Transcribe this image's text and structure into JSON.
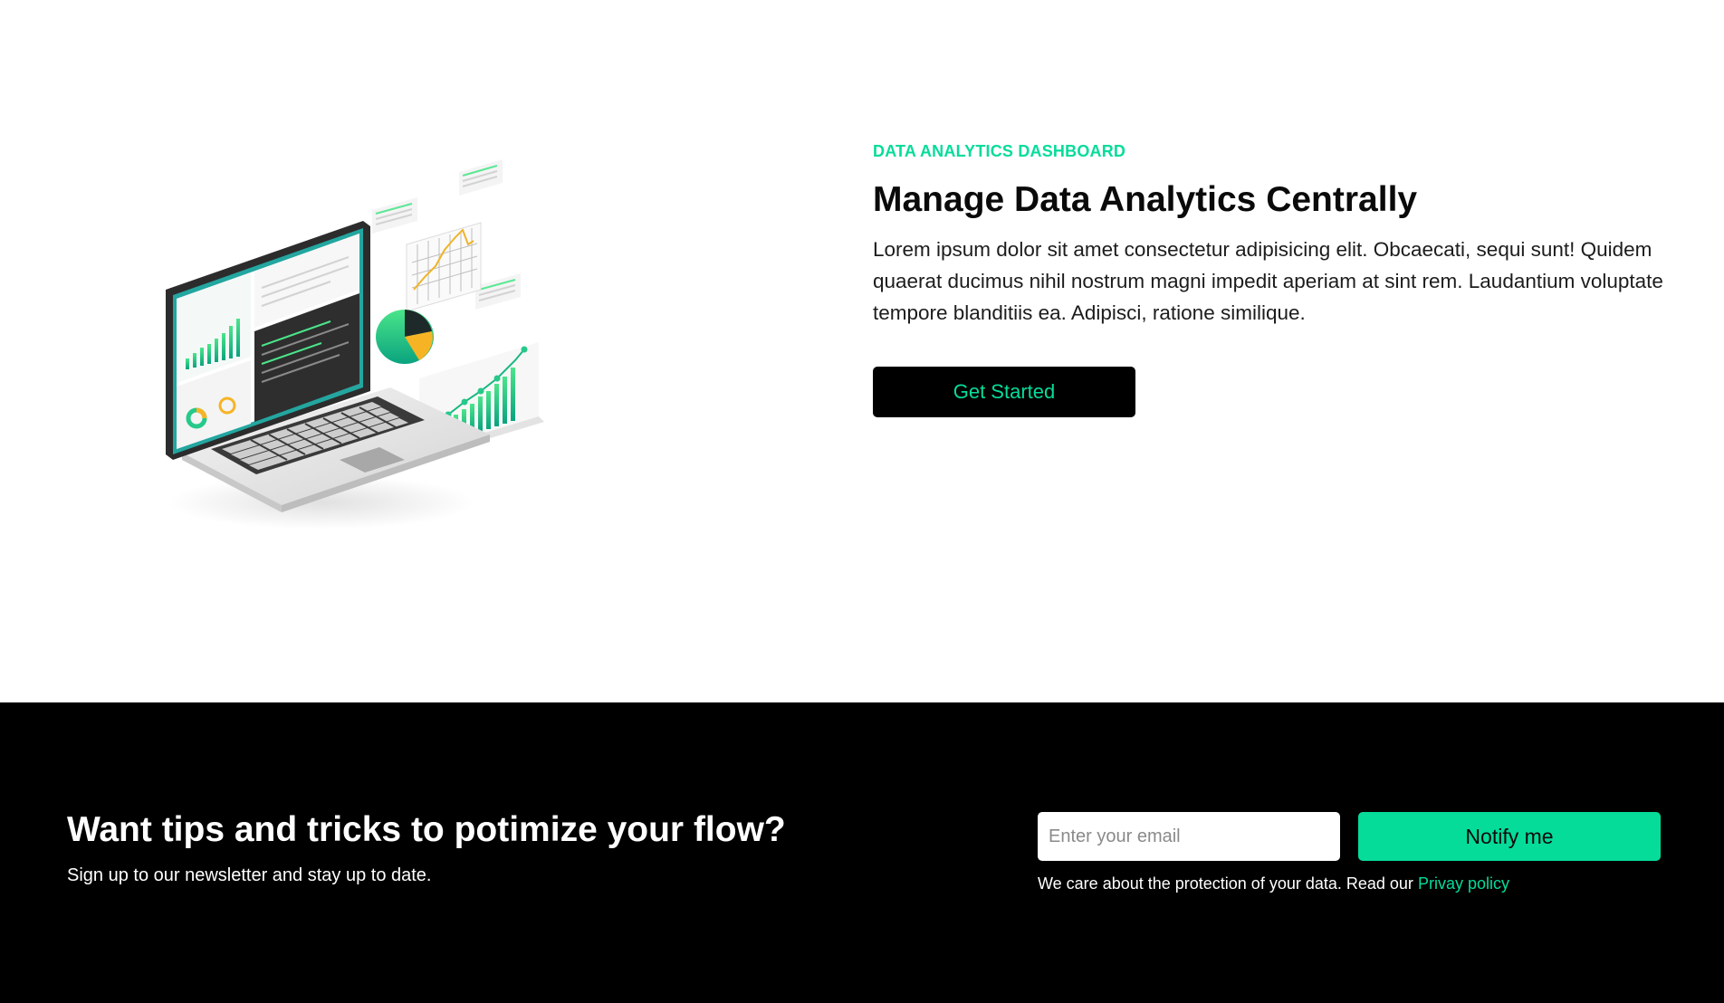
{
  "hero": {
    "eyebrow": "DATA ANALYTICS DASHBOARD",
    "title": "Manage Data Analytics Centrally",
    "description": "Lorem ipsum dolor sit amet consectetur adipisicing elit. Obcaecati, sequi sunt! Quidem quaerat ducimus nihil nostrum magni impedit aperiam at sint rem. Laudantium voluptate tempore blanditiis ea. Adipisci, ratione similique.",
    "cta_label": "Get Started",
    "illustration_icon": "analytics-laptop-illustration"
  },
  "newsletter": {
    "title": "Want tips and tricks to potimize your flow?",
    "subtitle": "Sign up to our newsletter and stay up to date.",
    "email_placeholder": "Enter your email",
    "email_value": "",
    "notify_label": "Notify me",
    "privacy_text": "We care about the protection of your data. Read our",
    "privacy_link": "Privay policy"
  },
  "colors": {
    "accent": "#05dc9a",
    "dark": "#000000",
    "background": "#ffffff"
  }
}
